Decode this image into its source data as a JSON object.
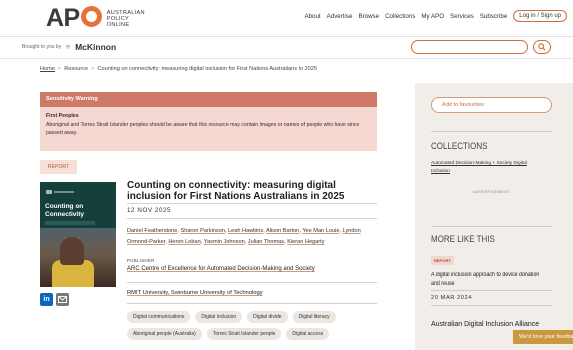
{
  "header": {
    "logo_text": "APO",
    "logo_sub": [
      "AUSTRALIAN",
      "POLICY",
      "ONLINE"
    ],
    "nav": [
      "About",
      "Advertise",
      "Browse",
      "Collections",
      "My APO",
      "Services",
      "Subscribe"
    ],
    "login": "Log in / Sign up",
    "sponsor_label": "Brought to you by",
    "sponsor_name": "McKinnon",
    "search_placeholder": "",
    "search_icon": "search-icon"
  },
  "breadcrumb": {
    "home": "Home",
    "resource": "Resource",
    "current": "Counting on connectivity: measuring digital inclusion for First Nations Australians in 2025"
  },
  "warning": {
    "heading": "Sensitivity Warning",
    "title": "First Peoples",
    "body": "Aboriginal and Torres Strait Islander peoples should be aware that this resource may contain images or names of people who have since passed away."
  },
  "resource": {
    "type": "REPORT",
    "cover_title": [
      "Counting on",
      "Connectivity"
    ],
    "title": "Counting on connectivity: measuring digital inclusion for First Nations Australians in 2025",
    "date": "12 NOV 2025",
    "authors": [
      "Daniel Featherstone",
      "Sharon Parkinson",
      "Leah Hawkins",
      "Alison Barton",
      "Yee Man Louie",
      "Lyndon Ormond-Parker",
      "Heron Loban",
      "Yasmin Johnson",
      "Julian Thomas",
      "Kieran Hegarty"
    ],
    "publisher_label": "PUBLISHER",
    "publisher": "ARC Centre of Excellence for Automated Decision-Making and Society",
    "publisher2": "RMIT University, Swinburne University of Technology",
    "tags": [
      "Digital communications",
      "Digital inclusion",
      "Digital divide",
      "Digital literacy",
      "Aboriginal people (Australia)",
      "Torres Strait Islander people",
      "Digital access"
    ]
  },
  "sidebar": {
    "favourites": "Add to favourites",
    "collections_heading": "COLLECTIONS",
    "collection_link": "Automated Decision-Making + Society Digital Inclusion",
    "advertisement": "ADVERTISEMENT",
    "more_heading": "MORE LIKE THIS",
    "item1_badge": "REPORT",
    "item1_title": "A digital inclusion approach to device donation and reuse",
    "item1_date": "20 MAR 2024",
    "item2_title": "Australian Digital Inclusion Alliance",
    "feedback": "We'd love your feedback"
  },
  "colors": {
    "accent": "#e8703a",
    "warning_header": "#cf7a66",
    "warning_bg": "#f6d8d2",
    "sidebar_bg": "#f1ede9"
  }
}
